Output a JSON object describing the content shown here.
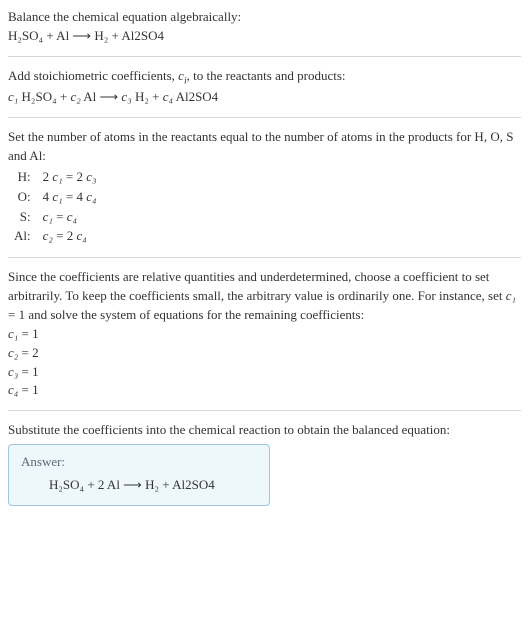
{
  "sec1": {
    "line1": "Balance the chemical equation algebraically:",
    "eq": "H₂SO₄ + Al ⟶ H₂ + Al2SO4"
  },
  "sec2": {
    "line1_a": "Add stoichiometric coefficients, ",
    "line1_ci": "c",
    "line1_i": "i",
    "line1_b": ", to the reactants and products:",
    "eq_c1": "c₁",
    "eq_p1": " H₂SO₄ + ",
    "eq_c2": "c₂",
    "eq_p2": " Al ⟶ ",
    "eq_c3": "c₃",
    "eq_p3": " H₂ + ",
    "eq_c4": "c₄",
    "eq_p4": " Al2SO4"
  },
  "sec3": {
    "line1": "Set the number of atoms in the reactants equal to the number of atoms in the products for H, O, S and Al:",
    "rows": [
      {
        "lbl": "H:",
        "eq_a": "2 ",
        "eq_c1": "c₁",
        "eq_m": " = 2 ",
        "eq_c2": "c₃"
      },
      {
        "lbl": "O:",
        "eq_a": "4 ",
        "eq_c1": "c₁",
        "eq_m": " = 4 ",
        "eq_c2": "c₄"
      },
      {
        "lbl": "S:",
        "eq_a": "",
        "eq_c1": "c₁",
        "eq_m": " = ",
        "eq_c2": "c₄"
      },
      {
        "lbl": "Al:",
        "eq_a": "",
        "eq_c1": "c₂",
        "eq_m": " = 2 ",
        "eq_c2": "c₄"
      }
    ]
  },
  "sec4": {
    "text_a": "Since the coefficients are relative quantities and underdetermined, choose a coefficient to set arbitrarily. To keep the coefficients small, the arbitrary value is ordinarily one. For instance, set ",
    "text_c1": "c₁",
    "text_b": " = 1 and solve the system of equations for the remaining coefficients:",
    "coeffs": [
      {
        "c": "c₁",
        "v": " = 1"
      },
      {
        "c": "c₂",
        "v": " = 2"
      },
      {
        "c": "c₃",
        "v": " = 1"
      },
      {
        "c": "c₄",
        "v": " = 1"
      }
    ]
  },
  "sec5": {
    "text": "Substitute the coefficients into the chemical reaction to obtain the balanced equation:"
  },
  "answer": {
    "hdr": "Answer:",
    "eq": "H₂SO₄ + 2 Al ⟶ H₂ + Al2SO4"
  }
}
